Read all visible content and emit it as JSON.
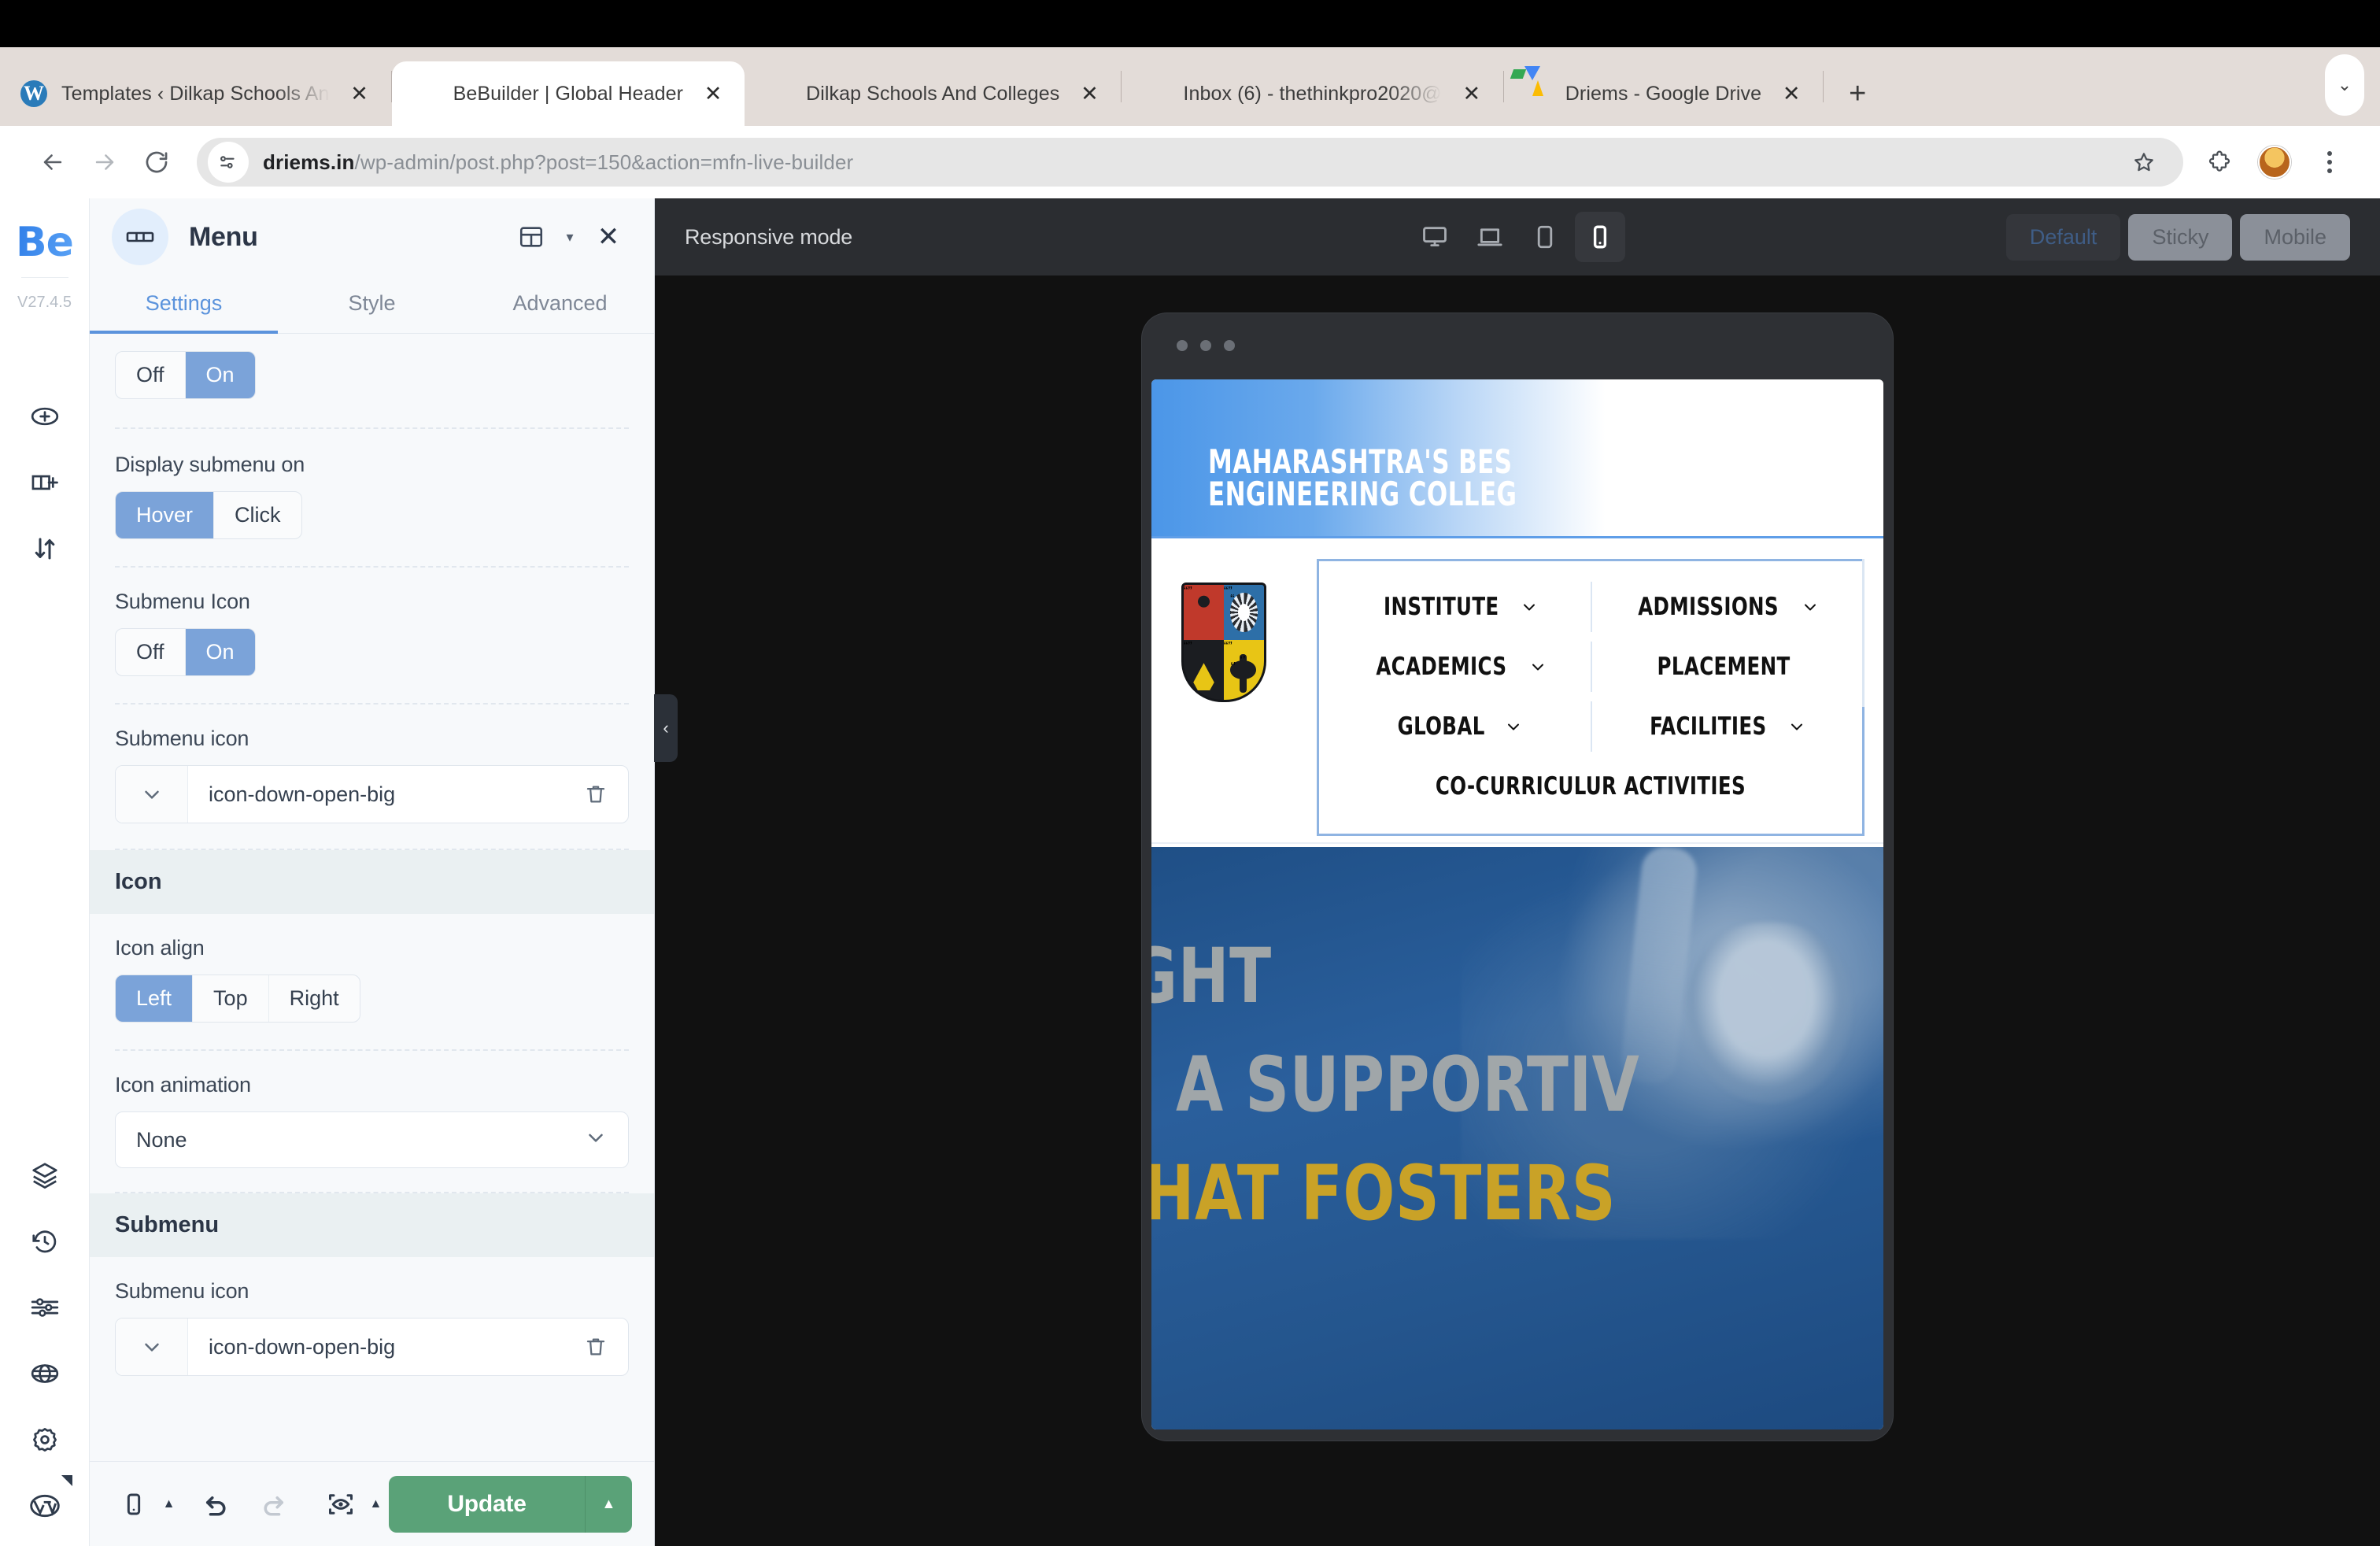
{
  "browser": {
    "tabs": [
      {
        "title": "Templates ‹ Dilkap Schools An",
        "favicon": "wordpress-icon",
        "active": false,
        "truncated": true
      },
      {
        "title": "BeBuilder | Global Header",
        "favicon": "crest-icon",
        "active": true,
        "truncated": false
      },
      {
        "title": "Dilkap Schools And Colleges",
        "favicon": "crest-icon",
        "active": false,
        "truncated": false
      },
      {
        "title": "Inbox (6) - thethinkpro2020@",
        "favicon": "gmail-icon",
        "active": false,
        "truncated": true
      },
      {
        "title": "Driems - Google Drive",
        "favicon": "google-drive-icon",
        "active": false,
        "truncated": false
      }
    ],
    "new_tab_label": "+",
    "tab_list_chevron": "⌄",
    "address": {
      "domain": "driems.in",
      "path": "/wp-admin/post.php?post=150&action=mfn-live-builder",
      "site_info_icon": "page-info-icon",
      "bookmark_icon": "star-icon",
      "extensions_icon": "extensions-icon",
      "menu_icon": "three-dot-menu-icon"
    },
    "nav": {
      "back": "back-arrow-icon",
      "forward": "forward-arrow-icon",
      "reload": "reload-icon"
    }
  },
  "rail": {
    "logo": "Be",
    "version": "V27.4.5",
    "top_icons": [
      "add-section-icon",
      "add-column-icon",
      "reorder-icon"
    ],
    "bottom_icons": [
      "layers-icon",
      "history-icon",
      "sliders-icon",
      "globe-icon",
      "gear-icon",
      "wordpress-icon"
    ]
  },
  "panel": {
    "title": "Menu",
    "title_icon": "menu-widget-icon",
    "layout_icon": "layout-icon",
    "layout_caret": "▾",
    "close_icon": "✕",
    "tabs": [
      {
        "label": "Settings",
        "active": true
      },
      {
        "label": "Style",
        "active": false
      },
      {
        "label": "Advanced",
        "active": false
      }
    ],
    "fields": [
      {
        "type": "segmented",
        "label": "",
        "options": [
          "Off",
          "On"
        ],
        "selected": "On"
      },
      {
        "type": "segmented",
        "label": "Display submenu on",
        "options": [
          "Hover",
          "Click"
        ],
        "selected": "Hover"
      },
      {
        "type": "segmented",
        "label": "Submenu Icon",
        "options": [
          "Off",
          "On"
        ],
        "selected": "On"
      },
      {
        "type": "iconfield",
        "label": "Submenu icon",
        "value": "icon-down-open-big",
        "picker_icon": "chevron-down-icon",
        "delete_icon": "trash-icon"
      }
    ],
    "section_icon": {
      "heading": "Icon",
      "align_label": "Icon align",
      "align_options": [
        "Left",
        "Top",
        "Right"
      ],
      "align_selected": "Left",
      "animation_label": "Icon animation",
      "animation_value": "None",
      "animation_chevron": "⌄"
    },
    "section_submenu": {
      "heading": "Submenu",
      "icon_label": "Submenu icon",
      "icon_value": "icon-down-open-big",
      "picker_icon": "chevron-down-icon",
      "delete_icon": "trash-icon"
    },
    "footer": {
      "device_icon": "mobile-icon",
      "device_caret": "▲",
      "undo_icon": "undo-icon",
      "redo_icon": "redo-icon",
      "preview_icon": "preview-eye-icon",
      "preview_caret": "▲",
      "update_label": "Update",
      "update_caret": "▲",
      "update_color": "#5aa278"
    },
    "collapse_handle_icon": "‹"
  },
  "canvas": {
    "responsive_label": "Responsive mode",
    "devices": [
      {
        "name": "desktop-icon",
        "active": false
      },
      {
        "name": "laptop-icon",
        "active": false
      },
      {
        "name": "tablet-icon",
        "active": false
      },
      {
        "name": "mobile-icon",
        "active": true
      }
    ],
    "modes": [
      {
        "label": "Default",
        "active": true
      },
      {
        "label": "Sticky",
        "active": false
      },
      {
        "label": "Mobile",
        "active": false
      }
    ]
  },
  "preview": {
    "band": {
      "line1": "MAHARASHTRA'S BES",
      "line2": "ENGINEERING COLLEG"
    },
    "logo_icon": "college-crest-icon",
    "menu_items": [
      {
        "label": "INSTITUTE",
        "has_submenu": true
      },
      {
        "label": "ADMISSIONS",
        "has_submenu": true
      },
      {
        "label": "ACADEMICS",
        "has_submenu": true
      },
      {
        "label": "PLACEMENT",
        "has_submenu": false
      },
      {
        "label": "GLOBAL",
        "has_submenu": true
      },
      {
        "label": "FACILITIES",
        "has_submenu": true
      },
      {
        "label": "CO-CURRICULUR ACTIVITIES",
        "has_submenu": false
      }
    ],
    "hero": {
      "line1": "IGHT",
      "line2": "H A SUPPORTIV",
      "line3": "THAT FOSTERS"
    },
    "colors": {
      "band_blue": "#4b96e8",
      "hero_blue": "#24558d",
      "hero_gold": "#c9a227",
      "menu_border": "#8fb4e2"
    }
  }
}
